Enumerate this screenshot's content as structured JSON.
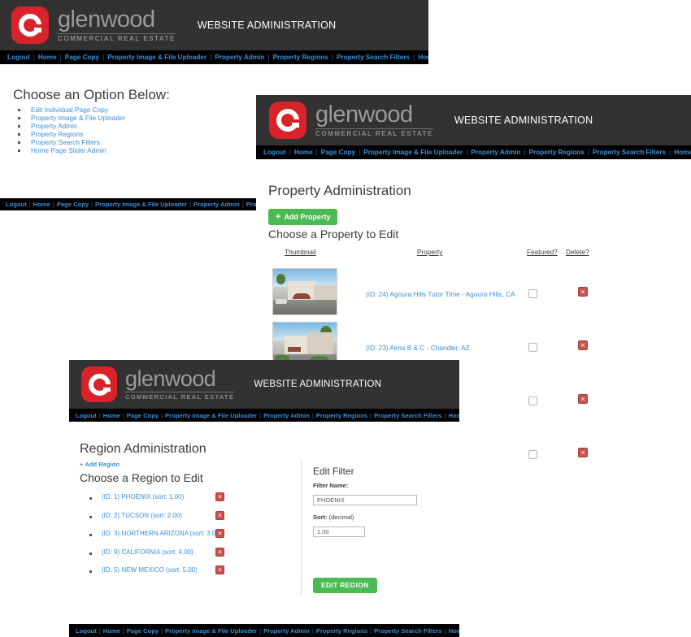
{
  "brand": {
    "wordmark": "glenwood",
    "tagline": "COMMERCIAL REAL ESTATE",
    "header_title": "WEBSITE ADMINISTRATION",
    "logo_letter": "G",
    "logo_color": "#d8232a",
    "header_bg": "#333132",
    "nav_bg": "#000000",
    "link_color": "#3a8fd8",
    "button_green": "#4cba52",
    "delete_red": "#c9544f"
  },
  "nav": {
    "items": [
      "Logout",
      "Home",
      "Page Copy",
      "Property Image & File Uploader",
      "Property Admin",
      "Property Regions",
      "Property Search Filters",
      "Home Page Slider Admin"
    ],
    "separator": "|"
  },
  "panel_menu": {
    "heading": "Choose an Option Below:",
    "options": [
      "Edit Individual Page Copy",
      "Property Image & File Uploader",
      "Property Admin",
      "Property Regions",
      "Property Search Filters",
      "Home Page Slider Admin"
    ]
  },
  "panel_property": {
    "title": "Property Administration",
    "add_button": "Add Property",
    "add_icon": "plus-icon",
    "subtitle": "Choose a Property to Edit",
    "columns": {
      "thumbnail": "Thumbnail",
      "property": "Property",
      "featured": "Featured?",
      "delete": "Delete?"
    },
    "rows": [
      {
        "label": "(ID: 24) Agoura Hills Tutor Time - Agoura Hills, CA",
        "featured": false,
        "delete_icon": "delete-icon"
      },
      {
        "label": "(ID: 23) Alma B & C - Chandler, AZ",
        "featured": false,
        "delete_icon": "delete-icon"
      },
      {
        "label": "",
        "featured": false,
        "delete_icon": "delete-icon"
      },
      {
        "label": "",
        "featured": false,
        "delete_icon": "delete-icon"
      }
    ]
  },
  "panel_region": {
    "title": "Region Administration",
    "add_link": "Add Region",
    "add_icon": "plus-icon",
    "subtitle": "Choose a Region to Edit",
    "regions": [
      {
        "label": "(ID: 1) PHOENIX (sort: 1.00)",
        "delete_icon": "delete-icon"
      },
      {
        "label": "(ID: 2) TUCSON (sort: 2.00)",
        "delete_icon": "delete-icon"
      },
      {
        "label": "(ID: 3) NORTHERN ARIZONA (sort: 3.00)",
        "delete_icon": "delete-icon"
      },
      {
        "label": "(ID: 9) CALIFORNIA (sort: 4.00)",
        "delete_icon": "delete-icon"
      },
      {
        "label": "(ID: 5) NEW MEXICO (sort: 5.00)",
        "delete_icon": "delete-icon"
      }
    ],
    "form": {
      "title": "Edit Filter",
      "name_label": "Filter Name:",
      "name_value": "PHOENIX",
      "sort_label": "Sort:",
      "sort_note": "(decimal)",
      "sort_value": "1.00",
      "submit": "EDIT REGION"
    }
  }
}
